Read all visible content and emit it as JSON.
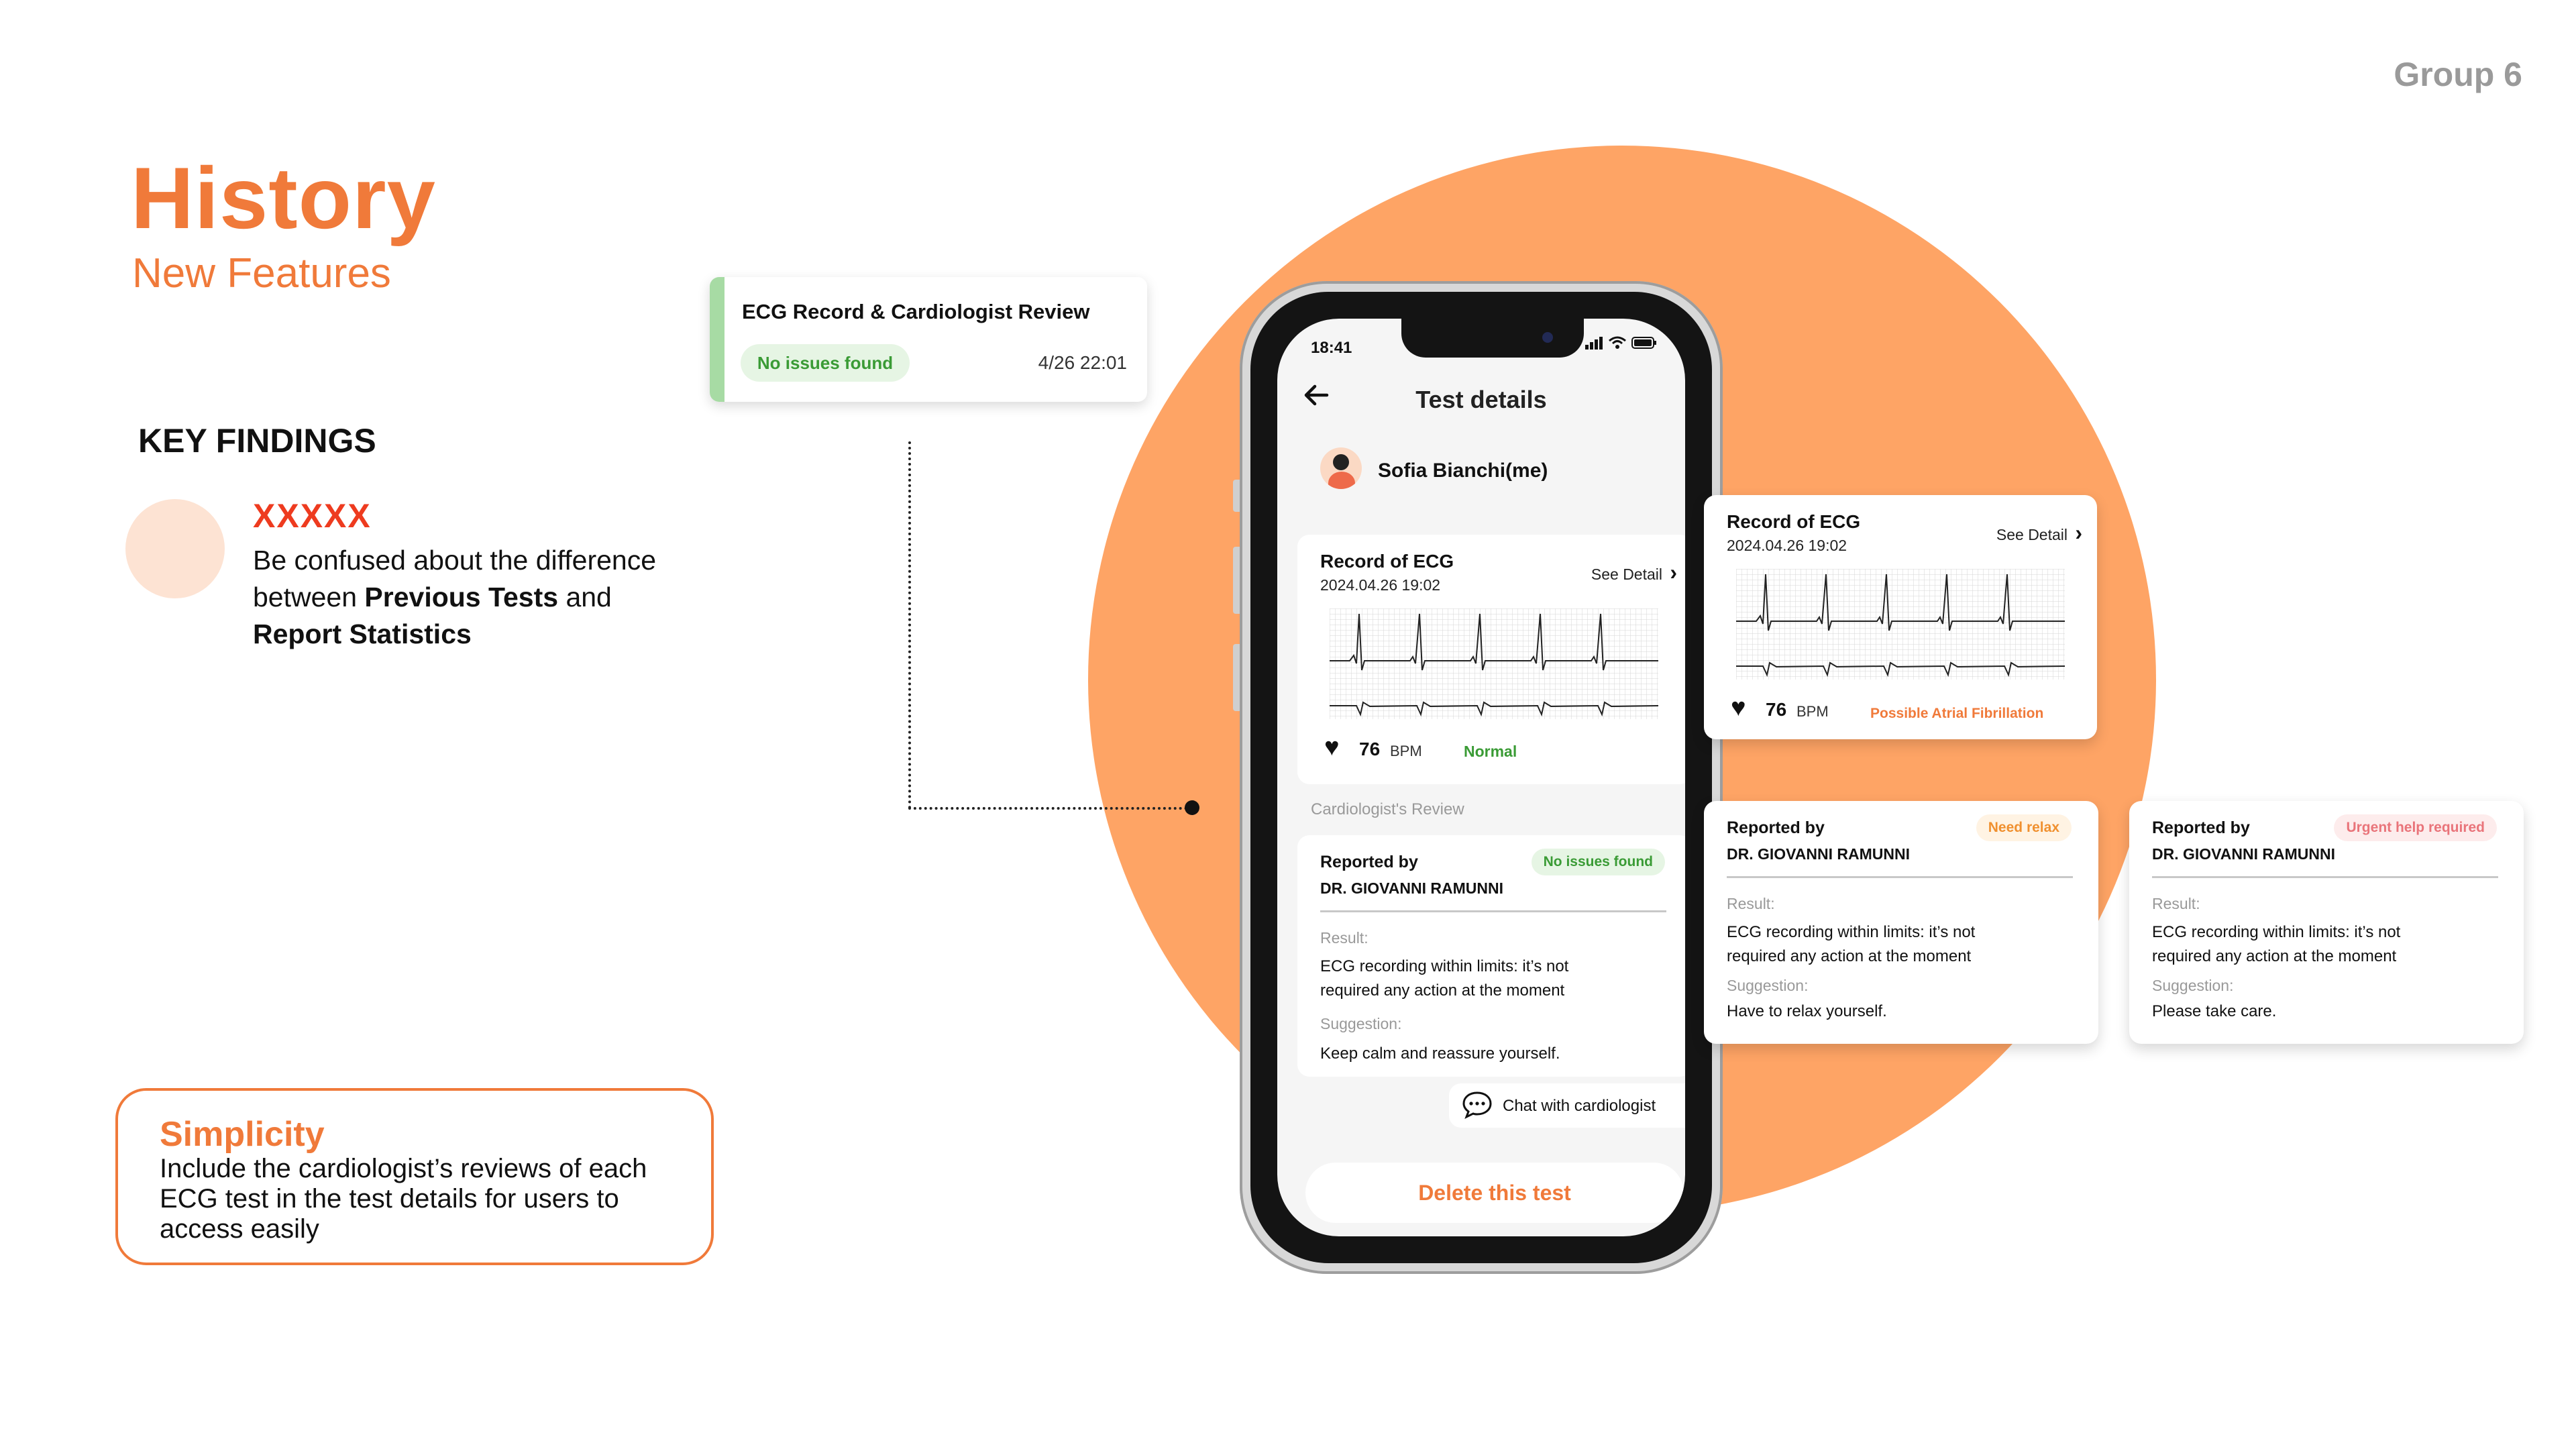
{
  "slide": {
    "group_label": "Group 6",
    "title": "History",
    "subtitle": "New Features",
    "key_findings": {
      "heading": "KEY FINDINGS",
      "marker": "XXXXX",
      "text_1": "Be confused about the difference between ",
      "bold_1": "Previous Tests",
      "text_2": " and ",
      "bold_2": "Report Statistics"
    },
    "simplicity": {
      "title": "Simplicity",
      "body": "Include the cardiologist’s reviews of each ECG test in the test details for users to access easily"
    }
  },
  "floating_card": {
    "title": "ECG Record & Cardiologist Review",
    "badge": "No issues found",
    "date": "4/26 22:01",
    "accent_color": "#a7dba4"
  },
  "phone": {
    "time": "18:41",
    "status_icons": "signal-icon wifi-icon battery-icon",
    "screen_title": "Test details",
    "user_name": "Sofia Bianchi(me)",
    "reviews_heading": "Cardiologist's Review",
    "chat_label": "Chat with cardiologist",
    "delete_label": "Delete this test"
  },
  "ecg_cards": [
    {
      "title": "Record of ECG",
      "date": "2024.04.26  19:02",
      "see_detail": "See Detail",
      "bpm": "76",
      "bpm_unit": "BPM",
      "status": "Normal",
      "status_color": "#3a9b35"
    },
    {
      "title": "Record of ECG",
      "date": "2024.04.26  19:02",
      "see_detail": "See Detail",
      "bpm": "76",
      "bpm_unit": "BPM",
      "status": "Possible Atrial Fibrillation",
      "status_color": "#f07a3a"
    }
  ],
  "review_cards": [
    {
      "reported_by": "Reported by",
      "doctor": "DR. GIOVANNI RAMUNNI",
      "badge": "No issues found",
      "badge_color": "#3a9b35",
      "badge_bg": "#e6f5e4",
      "result_label": "Result:",
      "result": "ECG recording within limits: it’s not required any action at the moment",
      "suggestion_label": "Suggestion:",
      "suggestion": "Keep calm and reassure yourself."
    },
    {
      "reported_by": "Reported by",
      "doctor": "DR. GIOVANNI RAMUNNI",
      "badge": "Need relax",
      "badge_color": "#f0902f",
      "badge_bg": "#fff3e3",
      "result_label": "Result:",
      "result": "ECG recording within limits: it’s not required any action at the moment",
      "suggestion_label": "Suggestion:",
      "suggestion": "Have to relax yourself."
    },
    {
      "reported_by": "Reported by",
      "doctor": "DR. GIOVANNI RAMUNNI",
      "badge": "Urgent help required",
      "badge_color": "#e9747a",
      "badge_bg": "#fdecec",
      "result_label": "Result:",
      "result": "ECG recording within limits: it’s not required any action at the moment",
      "suggestion_label": "Suggestion:",
      "suggestion": "Please take care."
    }
  ],
  "colors": {
    "accent": "#f07a3a",
    "circle": "#fea465"
  }
}
